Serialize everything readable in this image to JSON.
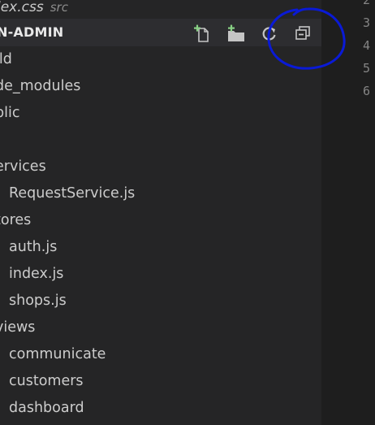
{
  "open_editor": {
    "file_name": "lex.css",
    "dir": "src"
  },
  "explorer": {
    "project_title": "N-ADMIN",
    "toolbar": {
      "new_file_icon": "new-file-icon",
      "new_folder_icon": "new-folder-icon",
      "refresh_icon": "refresh-icon",
      "collapse_all_icon": "collapse-all-icon"
    },
    "items": [
      {
        "label": "ild",
        "kind": "folder"
      },
      {
        "label": "de_modules",
        "kind": "folder"
      },
      {
        "label": "blic",
        "kind": "folder"
      },
      {
        "label": "",
        "kind": "folder"
      },
      {
        "label": "ervices",
        "kind": "folder"
      },
      {
        "label": "RequestService.js",
        "kind": "file"
      },
      {
        "label": "tores",
        "kind": "folder"
      },
      {
        "label": "auth.js",
        "kind": "file"
      },
      {
        "label": "index.js",
        "kind": "file"
      },
      {
        "label": "shops.js",
        "kind": "file"
      },
      {
        "label": "views",
        "kind": "folder"
      },
      {
        "label": "communicate",
        "kind": "file"
      },
      {
        "label": "customers",
        "kind": "file"
      },
      {
        "label": "dashboard",
        "kind": "file"
      }
    ]
  },
  "editor": {
    "line_numbers": [
      "2",
      "3",
      "4",
      "5",
      "6"
    ]
  },
  "colors": {
    "sidebar_bg": "#252526",
    "header_bg": "#2d2d30",
    "editor_bg": "#1e1e1e",
    "icon_green": "#89d185",
    "annotation_blue": "#0a1ad6"
  }
}
